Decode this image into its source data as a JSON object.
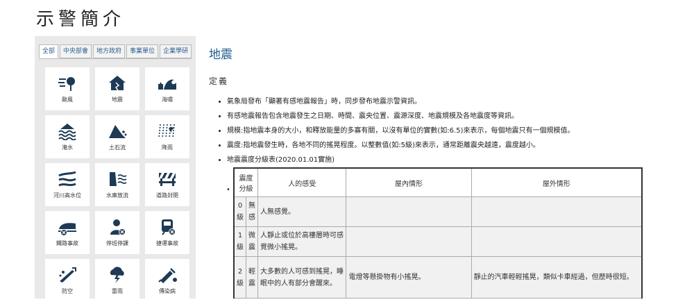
{
  "page_title": "示警簡介",
  "tabs": [
    {
      "label": "全部",
      "active": true
    },
    {
      "label": "中央部會"
    },
    {
      "label": "地方政府"
    },
    {
      "label": "事業單位"
    },
    {
      "label": "企業學研"
    }
  ],
  "tiles": [
    {
      "label": "颱風",
      "icon": "typhoon-icon"
    },
    {
      "label": "地震",
      "icon": "earthquake-icon"
    },
    {
      "label": "海嘯",
      "icon": "tsunami-icon"
    },
    {
      "label": "淹水",
      "icon": "flood-icon"
    },
    {
      "label": "土石流",
      "icon": "debris-flow-icon"
    },
    {
      "label": "降雨",
      "icon": "rain-icon"
    },
    {
      "label": "河川高水位",
      "icon": "river-high-water-icon"
    },
    {
      "label": "水庫放流",
      "icon": "reservoir-release-icon"
    },
    {
      "label": "道路封閉",
      "icon": "road-closure-icon"
    },
    {
      "label": "鐵路事故",
      "icon": "rail-accident-icon"
    },
    {
      "label": "停班停課",
      "icon": "office-school-closure-icon"
    },
    {
      "label": "捷運事故",
      "icon": "mrt-accident-icon"
    },
    {
      "label": "防空",
      "icon": "air-defense-icon"
    },
    {
      "label": "雷雨",
      "icon": "thunderstorm-icon"
    },
    {
      "label": "傳染病",
      "icon": "epidemic-icon"
    }
  ],
  "content": {
    "title": "地震",
    "definition_label": "定義",
    "bullets": [
      "氣象局發布「顯著有感地震報告」時，同步發布地震示警資訊。",
      "有感地震報告包含地震發生之日期、時間、震央位置、震源深度、地震規模及各地震度等資訊。",
      "規模:指地震本身的大小，和釋放能量的多寡有關，以沒有單位的實數(如:6.5)來表示，每個地震只有一個規模值。",
      "震度:指地震發生時，各地不同的搖晃程度。以整數值(如:5級)來表示，通常距離震央越遠，震度越小。",
      "地震震度分級表(2020.01.01實施)"
    ],
    "table": {
      "headers": [
        "震度分級",
        "人的感受",
        "屋內情形",
        "屋外情形"
      ],
      "rows": [
        {
          "level": "0級",
          "name": "無感",
          "feel": "人無感覺。",
          "indoor": "",
          "outdoor": ""
        },
        {
          "level": "1級",
          "name": "微震",
          "feel": "人靜止或位於高樓層時可感覺微小搖晃。",
          "indoor": "",
          "outdoor": ""
        },
        {
          "level": "2級",
          "name": "輕震",
          "feel": "大多數的人可感到搖晃，睡眠中的人有部分會醒來。",
          "indoor": "電燈等懸掛物有小搖晃。",
          "outdoor": "靜止的汽車輕輕搖晃，類似卡車經過，但歷時很短。"
        }
      ]
    }
  },
  "colors": {
    "accent": "#1f5b8e",
    "icon": "#1e3a55",
    "sidebar_bg": "#e9e9e9"
  }
}
